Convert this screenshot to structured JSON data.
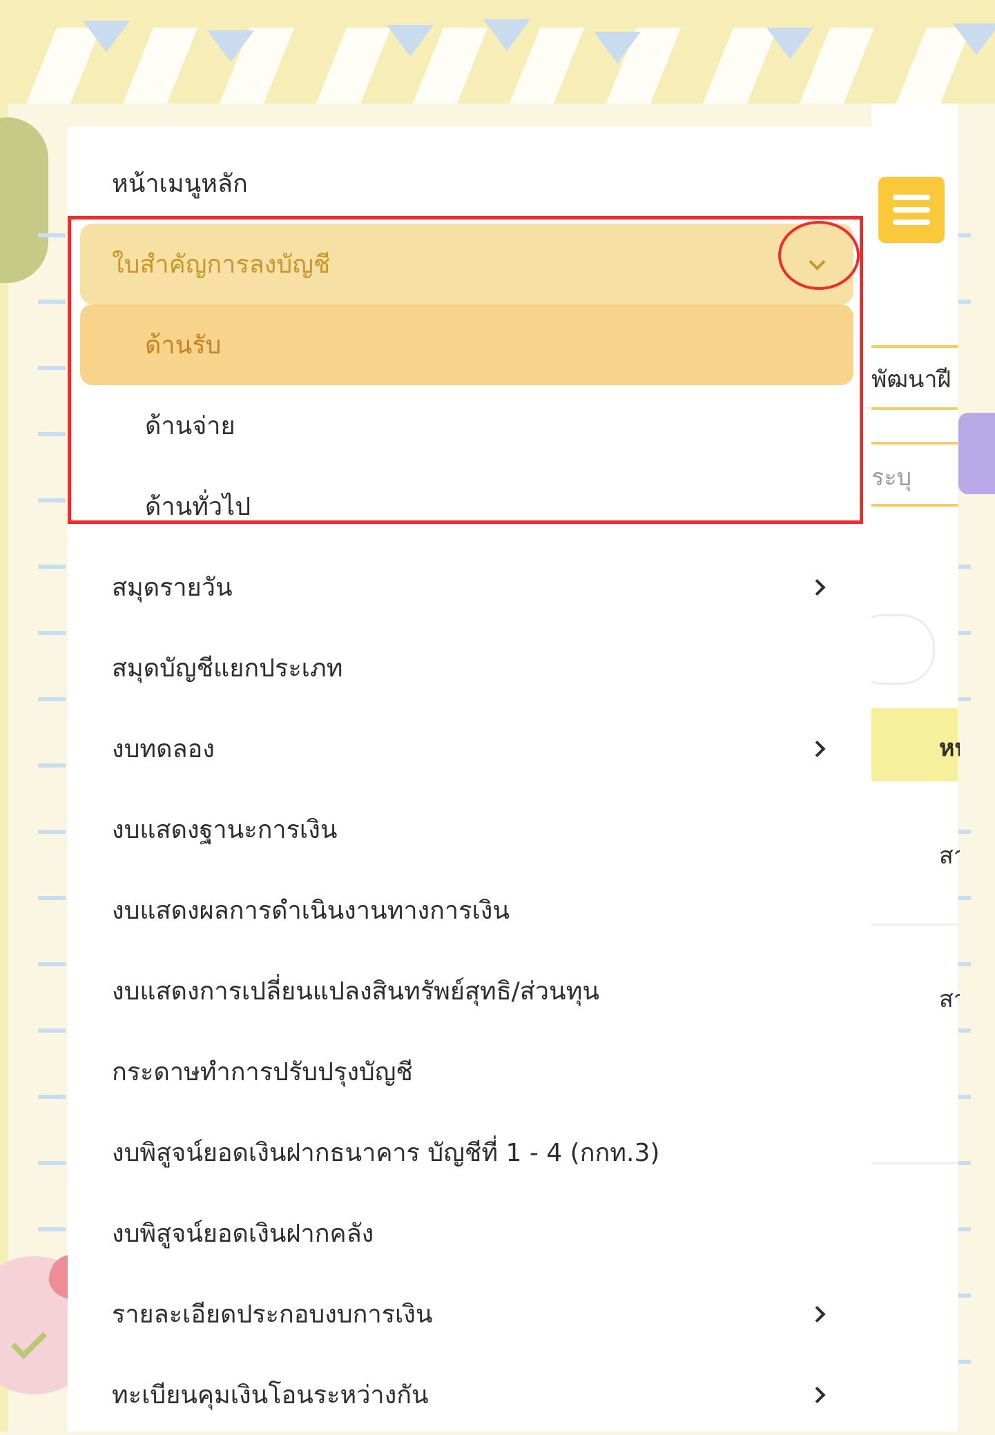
{
  "menu": {
    "items": [
      {
        "label": "หน้าเมนูหลัก",
        "chevron": "none"
      },
      {
        "label": "ใบสำคัญการลงบัญชี",
        "chevron": "chevron-down-icon",
        "expanded": true
      },
      {
        "label": "ด้านรับ",
        "sub": true,
        "active": true
      },
      {
        "label": "ด้านจ่าย",
        "sub": true
      },
      {
        "label": "ด้านทั่วไป",
        "sub": true
      },
      {
        "label": "สมุดรายวัน",
        "chevron": "chevron-right-icon"
      },
      {
        "label": "สมุดบัญชีแยกประเภท",
        "chevron": "none"
      },
      {
        "label": "งบทดลอง",
        "chevron": "chevron-right-icon"
      },
      {
        "label": "งบแสดงฐานะการเงิน",
        "chevron": "none"
      },
      {
        "label": "งบแสดงผลการดำเนินงานทางการเงิน",
        "chevron": "none"
      },
      {
        "label": "งบแสดงการเปลี่ยนแปลงสินทรัพย์สุทธิ/ส่วนทุน",
        "chevron": "none"
      },
      {
        "label": "กระดาษทำการปรับปรุงบัญชี",
        "chevron": "none"
      },
      {
        "label": "งบพิสูจน์ยอดเงินฝากธนาคาร บัญชีที่ 1 - 4 (กกท.3)",
        "chevron": "none"
      },
      {
        "label": "งบพิสูจน์ยอดเงินฝากคลัง",
        "chevron": "none"
      },
      {
        "label": "รายละเอียดประกอบงบการเงิน",
        "chevron": "chevron-right-icon"
      },
      {
        "label": "ทะเบียนคุมเงินโอนระหว่างกัน",
        "chevron": "chevron-right-icon"
      }
    ]
  },
  "background_page": {
    "field_1_text": "พัฒนาฝี",
    "field_2_placeholder": "ระบุ",
    "table_header_text": "หน",
    "row_1_text": "สา",
    "row_2_text": "สา",
    "hamburger_icon": "menu-icon"
  },
  "colors": {
    "accent_yellow": "#f9c83b",
    "highlight_parent": "#f7e0a4",
    "highlight_active": "#f7d38c",
    "annotation_red": "#ee2c2c"
  }
}
